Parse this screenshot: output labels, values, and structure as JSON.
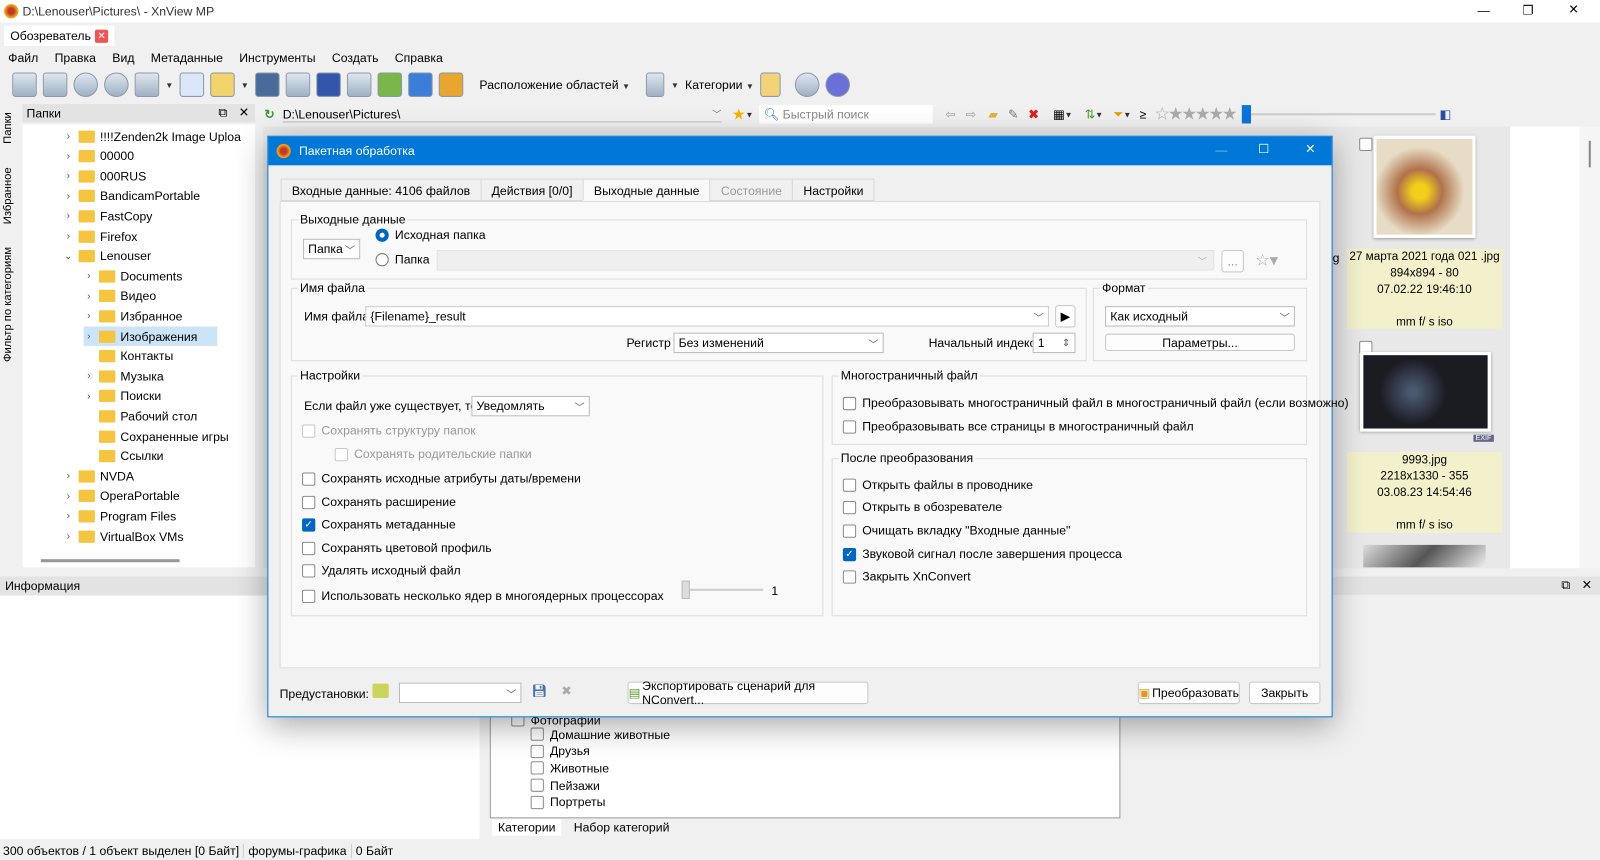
{
  "window": {
    "title": "D:\\Lenouser\\Pictures\\ - XnView MP",
    "minimize": "—",
    "maximize": "❐",
    "close": "✕"
  },
  "browser_tab": {
    "label": "Обозреватель"
  },
  "menu": [
    "Файл",
    "Правка",
    "Вид",
    "Метаданные",
    "Инструменты",
    "Создать",
    "Справка"
  ],
  "toolbar": {
    "layout_label": "Расположение областей",
    "categories_label": "Категории"
  },
  "folders_panel": {
    "title": "Папки",
    "side_tabs": [
      "Папки",
      "Избранное",
      "Фильтр по категориям"
    ],
    "tree": [
      {
        "label": "!!!!Zenden2k Image Uploa",
        "level": 0
      },
      {
        "label": "00000",
        "level": 0
      },
      {
        "label": "000RUS",
        "level": 0
      },
      {
        "label": "BandicamPortable",
        "level": 0
      },
      {
        "label": "FastCopy",
        "level": 0
      },
      {
        "label": "Firefox",
        "level": 0
      },
      {
        "label": "Lenouser",
        "level": 0,
        "expanded": true
      },
      {
        "label": "Documents",
        "level": 1
      },
      {
        "label": "Видео",
        "level": 1
      },
      {
        "label": "Избранное",
        "level": 1
      },
      {
        "label": "Изображения",
        "level": 1,
        "selected": true
      },
      {
        "label": "Контакты",
        "level": 1
      },
      {
        "label": "Музыка",
        "level": 1
      },
      {
        "label": "Поиски",
        "level": 1
      },
      {
        "label": "Рабочий стол",
        "level": 1
      },
      {
        "label": "Сохраненные игры",
        "level": 1
      },
      {
        "label": "Ссылки",
        "level": 1
      },
      {
        "label": "NVDA",
        "level": 0
      },
      {
        "label": "OperaPortable",
        "level": 0
      },
      {
        "label": "Program Files",
        "level": 0
      },
      {
        "label": "VirtualBox VMs",
        "level": 0
      }
    ]
  },
  "address_bar": {
    "path": "D:\\Lenouser\\Pictures\\",
    "search_placeholder": "Быстрый поиск",
    "filter_symbol": "≥"
  },
  "thumbnails": [
    {
      "name": "27 марта 2021 года 021 .jpg",
      "dims": "894x894 - 80",
      "date": "07.02.22 19:46:10",
      "exif": "mm f/ s iso"
    },
    {
      "name": "9993.jpg",
      "dims": "2218x1330 - 355",
      "date": "03.08.23 14:54:46",
      "exif": "mm f/ s iso",
      "badge": "EXIF"
    }
  ],
  "partial_caption": "g",
  "info_panel": {
    "title": "Информация"
  },
  "categories_panel": {
    "parent": "Фотографии",
    "items": [
      "Домашние животные",
      "Друзья",
      "Животные",
      "Пейзажи",
      "Портреты"
    ],
    "tabs": [
      "Категории",
      "Набор категорий"
    ]
  },
  "status_bar": [
    "300 объектов / 1 объект выделен [0 Байт]",
    "форумы-графика",
    "0 Байт"
  ],
  "dialog": {
    "title": "Пакетная обработка",
    "tabs": [
      "Входные данные: 4106 файлов",
      "Действия [0/0]",
      "Выходные данные",
      "Состояние",
      "Настройки"
    ],
    "output": {
      "legend": "Выходные данные",
      "mode": "Папка",
      "radio_source": "Исходная папка",
      "radio_folder": "Папка",
      "browse": "..."
    },
    "filename": {
      "legend": "Имя файла",
      "label": "Имя файла",
      "value": "{Filename}_result",
      "case_label": "Регистр",
      "case_value": "Без изменений",
      "start_label": "Начальный индекс",
      "start_value": "1"
    },
    "format": {
      "legend": "Формат",
      "value": "Как исходный",
      "params": "Параметры..."
    },
    "settings": {
      "legend": "Настройки",
      "exists_label": "Если файл уже существует, то",
      "exists_value": "Уведомлять",
      "checks": [
        {
          "label": "Сохранять структуру папок",
          "checked": false,
          "disabled": true
        },
        {
          "label": "Сохранять родительские папки",
          "checked": false,
          "disabled": true
        },
        {
          "label": "Сохранять исходные атрибуты даты/времени",
          "checked": false
        },
        {
          "label": "Сохранять расширение",
          "checked": false
        },
        {
          "label": "Сохранять метаданные",
          "checked": true
        },
        {
          "label": "Сохранять цветовой профиль",
          "checked": false
        },
        {
          "label": "Удалять исходный файл",
          "checked": false
        },
        {
          "label": "Использовать несколько ядер в многоядерных процессорах",
          "checked": false
        }
      ],
      "cores_value": "1"
    },
    "multipage": {
      "legend": "Многостраничный файл",
      "checks": [
        {
          "label": "Преобразовывать многостраничный файл в многостраничный файл (если возможно)",
          "checked": false
        },
        {
          "label": "Преобразовывать все страницы в многостраничный файл",
          "checked": false
        }
      ]
    },
    "after": {
      "legend": "После преобразования",
      "checks": [
        {
          "label": "Открыть файлы в проводнике",
          "checked": false
        },
        {
          "label": "Открыть в обозревателе",
          "checked": false
        },
        {
          "label": "Очищать вкладку \"Входные данные\"",
          "checked": false
        },
        {
          "label": "Звуковой сигнал после завершения процесса",
          "checked": true
        },
        {
          "label": "Закрыть XnConvert",
          "checked": false
        }
      ]
    },
    "presets_label": "Предустановки:",
    "export_button": "Экспортировать сценарий для NConvert...",
    "convert_button": "Преобразовать",
    "close_button": "Закрыть"
  },
  "colors": {
    "accent": "#0078d7",
    "caption_bg": "#f3f1cc",
    "selected": "#cce4f7"
  }
}
